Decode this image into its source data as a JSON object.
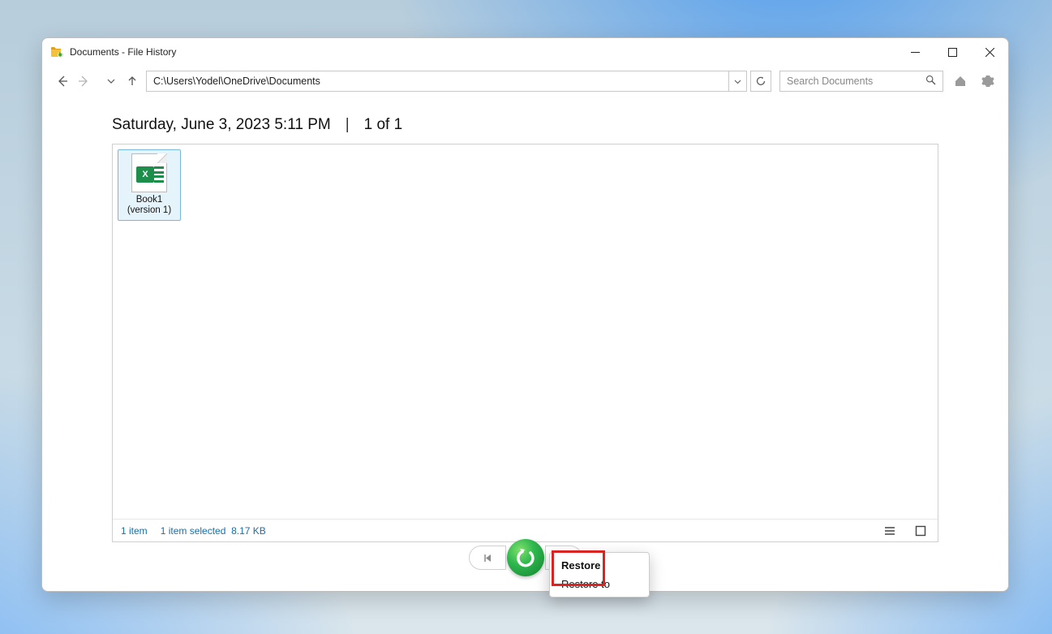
{
  "window": {
    "title": "Documents - File History"
  },
  "nav": {
    "path": "C:\\Users\\Yodel\\OneDrive\\Documents",
    "search_placeholder": "Search Documents"
  },
  "heading": {
    "timestamp": "Saturday, June 3, 2023 5:11 PM",
    "separator": "|",
    "position": "1 of 1"
  },
  "files": [
    {
      "name_line1": "Book1",
      "name_line2": "(version 1)",
      "icon": "excel"
    }
  ],
  "status": {
    "count": "1 item",
    "selected": "1 item selected",
    "size": "8.17 KB"
  },
  "context_menu": {
    "restore": "Restore",
    "restore_to": "Restore to"
  }
}
